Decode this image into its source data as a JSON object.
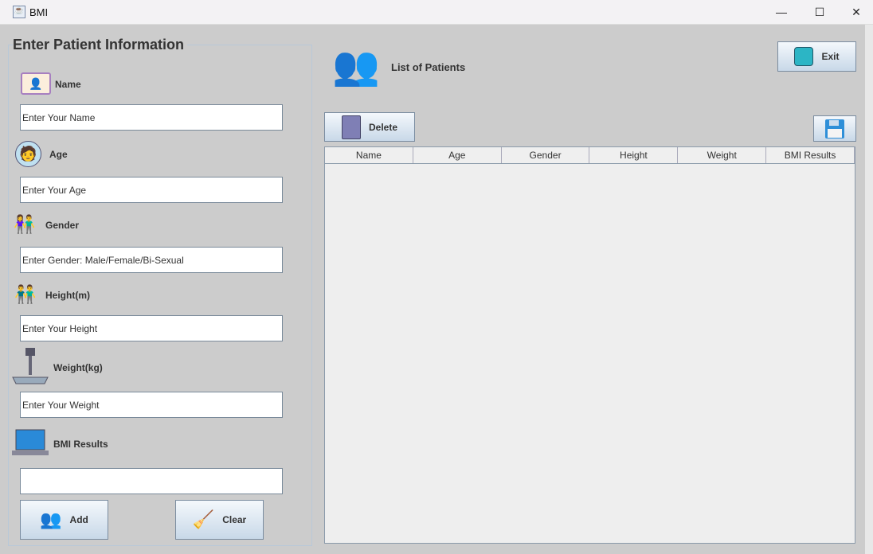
{
  "window": {
    "title": "BMI",
    "minimize": "—",
    "maximize": "☐",
    "close": "✕"
  },
  "form": {
    "heading": "Enter Patient Information",
    "name_label": "Name",
    "name_value": "Enter Your Name",
    "age_label": "Age",
    "age_value": "Enter Your Age",
    "gender_label": "Gender",
    "gender_value": "Enter Gender: Male/Female/Bi-Sexual",
    "height_label": "Height(m)",
    "height_value": "Enter Your Height",
    "weight_label": "Weight(kg)",
    "weight_value": "Enter Your Weight",
    "bmi_label": "BMI Results",
    "bmi_value": "",
    "add_label": "Add",
    "clear_label": "Clear"
  },
  "patients": {
    "title": "List of Patients",
    "exit_label": "Exit",
    "delete_label": "Delete",
    "columns": [
      "Name",
      "Age",
      "Gender",
      "Height",
      "Weight",
      "BMI Results"
    ]
  }
}
